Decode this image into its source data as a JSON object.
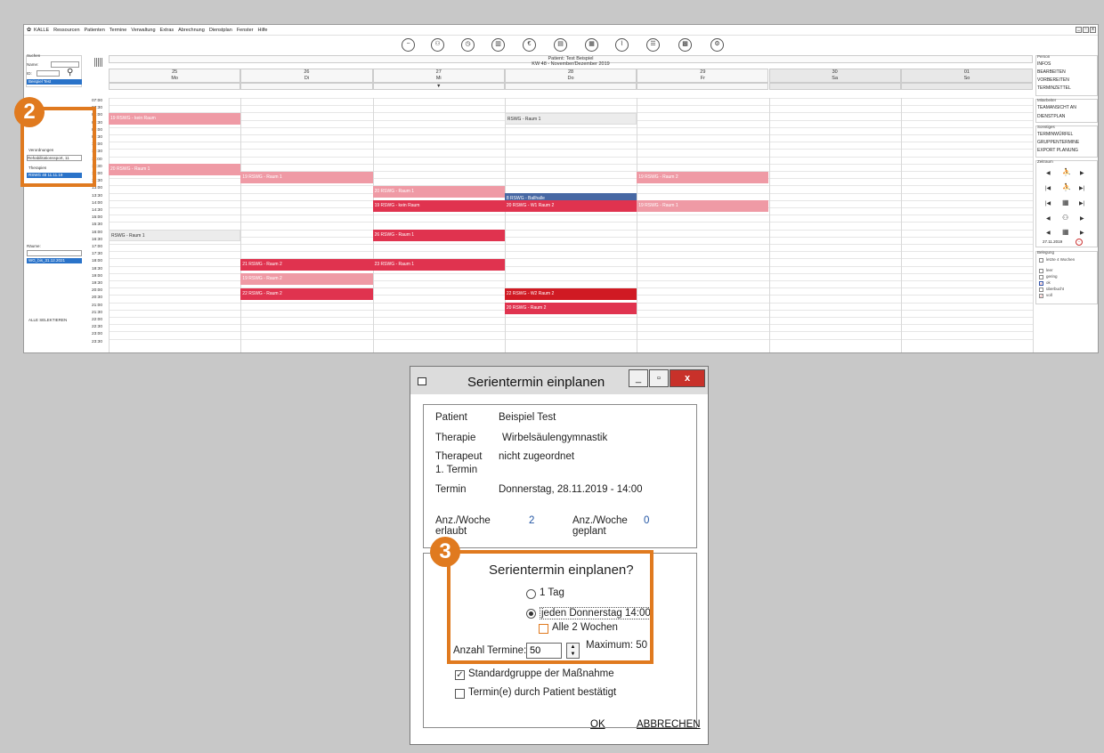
{
  "app": {
    "name": "KALLE",
    "menu": [
      "Ressourcen",
      "Patienten",
      "Termine",
      "Verwaltung",
      "Extras",
      "Abrechnung",
      "Dienstplan",
      "Fenster",
      "Hilfe"
    ],
    "window_controls": [
      "_",
      "▫",
      "x"
    ]
  },
  "left": {
    "suchen": "Suchen",
    "name_label": "Name:",
    "id_label": "ID:",
    "selected_patient": "Beispiel Test",
    "verordnungen_label": "Verordnungen",
    "verordnung_value": "Rehabilitationssport, 11",
    "therapien_label": "Therapien",
    "therapie_item": "RSWG 48 11.11.19",
    "raeume_label": "Räume:",
    "raum_item": "WG_bis_31.12.2021",
    "alle_selektieren": "ALLE SELEKTIEREN"
  },
  "calendar": {
    "patient_title": "Patient: Test Beispiel",
    "week_title": "KW 48  -  November/Dezember 2019",
    "days": [
      {
        "date": "25",
        "name": "Mo"
      },
      {
        "date": "26",
        "name": "Di"
      },
      {
        "date": "27",
        "name": "Mi"
      },
      {
        "date": "28",
        "name": "Do"
      },
      {
        "date": "29",
        "name": "Fr"
      },
      {
        "date": "30",
        "name": "Sa"
      },
      {
        "date": "01",
        "name": "So"
      }
    ],
    "times": [
      "07:00",
      "07:30",
      "08:00",
      "08:30",
      "09:00",
      "09:30",
      "10:00",
      "10:30",
      "11:00",
      "11:30",
      "12:00",
      "12:30",
      "13:00",
      "13:30",
      "14:00",
      "14:30",
      "15:00",
      "15:30",
      "16:00",
      "16:30",
      "17:00",
      "17:30",
      "18:00",
      "18:30",
      "19:00",
      "19:30",
      "20:00",
      "20:30",
      "21:00",
      "21:30",
      "22:00",
      "22:30",
      "23:00",
      "23:30"
    ],
    "events": [
      {
        "day": 0,
        "slot": 2,
        "label": "19 RSWG - kein Raum",
        "color": "pink"
      },
      {
        "day": 3,
        "slot": 2,
        "label": "RSWG - Raum 1",
        "color": "grey"
      },
      {
        "day": 0,
        "slot": 9,
        "label": "20 RSWG - Raum 1",
        "color": "pink"
      },
      {
        "day": 1,
        "slot": 10,
        "label": "19 RSWG - Raum 1",
        "color": "pink"
      },
      {
        "day": 4,
        "slot": 10,
        "label": "19 RSWG - Raum 2",
        "color": "pink"
      },
      {
        "day": 2,
        "slot": 12,
        "label": "20 RSWG - Raum 1",
        "color": "pink"
      },
      {
        "day": 3,
        "slot": 13,
        "label": "8 RSWG - Ballhalle",
        "color": "blue"
      },
      {
        "day": 2,
        "slot": 14,
        "label": "19 RSWG - kein Raum",
        "color": "red"
      },
      {
        "day": 3,
        "slot": 14,
        "label": "20 RSWG - W1 Raum 2",
        "color": "red"
      },
      {
        "day": 4,
        "slot": 14,
        "label": "19 RSWG - Raum 1",
        "color": "pink"
      },
      {
        "day": 0,
        "slot": 18,
        "label": "RSWG - Raum 1",
        "color": "grey"
      },
      {
        "day": 2,
        "slot": 18,
        "label": "26 RSWG - Raum 1",
        "color": "red"
      },
      {
        "day": 1,
        "slot": 22,
        "label": "21 RSWG - Raum 2",
        "color": "red"
      },
      {
        "day": 2,
        "slot": 22,
        "label": "23 RSWG - Raum 1",
        "color": "red"
      },
      {
        "day": 1,
        "slot": 24,
        "label": "19 RSWG - Raum 2",
        "color": "pink"
      },
      {
        "day": 1,
        "slot": 26,
        "label": "22 RSWG - Raum 2",
        "color": "red"
      },
      {
        "day": 3,
        "slot": 26,
        "label": "22 RSWG - W2 Raum 2",
        "color": "dred"
      },
      {
        "day": 3,
        "slot": 28,
        "label": "20 RSWG - Raum 2",
        "color": "red"
      }
    ]
  },
  "right": {
    "person_title": "Person",
    "person_links": [
      "INFOS",
      "BEARBEITEN",
      "VORBEREITEN",
      "TERMINZETTEL"
    ],
    "mitarbeiter_title": "Mitarbeiter",
    "mitarbeiter_links": [
      "TEAMANSICHT AN",
      "DIENSTPLAN"
    ],
    "sonstiges_title": "Sonstiges",
    "sonstiges_links": [
      "TERMINWÜRFEL",
      "GRUPPENTERMINE",
      "EXPORT PLANUNG"
    ],
    "zeitraum_title": "Zeitraum",
    "zeitraum_date": "27.11.2019",
    "belegung_title": "Belegung",
    "letzte_4_wochen": "letzte 4 Wochen",
    "belegung_items": [
      "leer",
      "gering",
      "ok",
      "überbucht",
      "voll"
    ]
  },
  "badges": {
    "two": "2",
    "three": "3"
  },
  "dialog": {
    "title": "Serientermin einplanen",
    "patient_label": "Patient",
    "patient_value": "Beispiel Test",
    "therapie_label": "Therapie",
    "therapie_value": "Wirbelsäulengymnastik",
    "therapeut_label": "Therapeut",
    "termin1_label": "1. Termin",
    "therapeut_value": "nicht zugeordnet",
    "termin_label": "Termin",
    "termin_value": "Donnerstag, 28.11.2019 - 14:00",
    "anz_erlaubt_label1": "Anz./Woche",
    "anz_erlaubt_label2": "erlaubt",
    "anz_erlaubt_value": "2",
    "anz_geplant_label1": "Anz./Woche",
    "anz_geplant_label2": "geplant",
    "anz_geplant_value": "0",
    "question": "Serientermin einplanen?",
    "option_1tag": "1 Tag",
    "option_jeden": "jeden Donnerstag 14:00",
    "alle_2_wochen": "Alle 2 Wochen",
    "anzahl_label": "Anzahl Termine:",
    "anzahl_value": "50",
    "maximum_label": "Maximum: 50",
    "standardgruppe": "Standardgruppe der Maßnahme",
    "bestaetigt": "Termin(e) durch Patient bestätigt",
    "ok": "OK",
    "abbrechen": "ABBRECHEN"
  }
}
